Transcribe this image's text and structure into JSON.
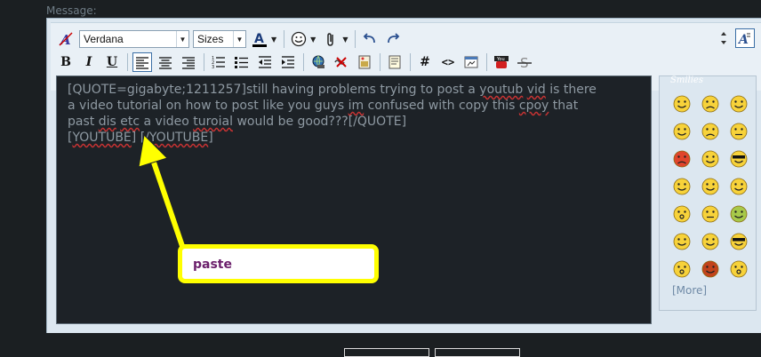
{
  "message_label": "Message:",
  "toolbar": {
    "font_value": "Verdana",
    "size_value": "Sizes",
    "bold": "B",
    "italic": "I",
    "underline": "U",
    "hash": "#",
    "code": "<>"
  },
  "editor": {
    "lines": [
      "[QUOTE=gigabyte;1211257]still having problems trying to post a youtub vid is there",
      "a video tutorial on how to post like you guys im confused with copy this cpoy that",
      "past dis etc a video turoial would be good???[/QUOTE]",
      "[YOUTUBE] [/YOUTUBE]"
    ]
  },
  "smilies": {
    "title": "Smilies",
    "more": "[More]"
  },
  "callout": {
    "text": "paste"
  },
  "colors": {
    "accent_yellow": "#ffff00",
    "callout_text": "#6b1f6b"
  }
}
